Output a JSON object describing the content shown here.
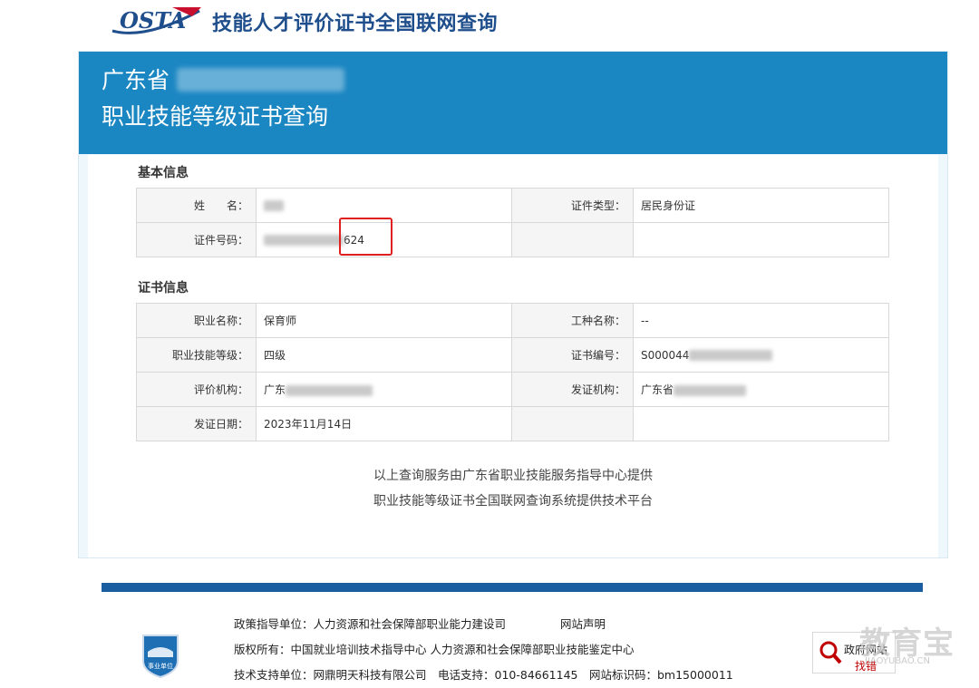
{
  "header": {
    "logo_text": "OSTA",
    "title": "技能人才评价证书全国联网查询"
  },
  "banner": {
    "line1": "广东省",
    "line2": "职业技能等级证书查询"
  },
  "basic": {
    "section_title": "基本信息",
    "name_label": "姓　　名：",
    "id_type_label": "证件类型：",
    "id_type_value": "居民身份证",
    "id_no_label": "证件号码：",
    "id_no_value_suffix": "624"
  },
  "cert": {
    "section_title": "证书信息",
    "occupation_label": "职业名称：",
    "occupation_value": "保育师",
    "trade_label": "工种名称：",
    "trade_value": "--",
    "level_label": "职业技能等级：",
    "level_value": "四级",
    "cert_no_label": "证书编号：",
    "cert_no_value": "S000044",
    "eval_org_label": "评价机构：",
    "eval_org_value": "广东",
    "issue_org_label": "发证机构：",
    "issue_org_value": "广东省",
    "issue_date_label": "发证日期：",
    "issue_date_value": "2023年11月14日"
  },
  "notes": {
    "line1": "以上查询服务由广东省职业技能服务指导中心提供",
    "line2": "职业技能等级证书全国联网查询系统提供技术平台"
  },
  "footer": {
    "policy": "政策指导单位：人力资源和社会保障部职业能力建设司",
    "statement": "网站声明",
    "copyright": "版权所有：中国就业培训技术指导中心 人力资源和社会保障部职业技能鉴定中心",
    "support": "技术支持单位：网鼎明天科技有限公司　电话支持：010-84661145　网站标识码：bm15000011",
    "badge_label": "事业单位",
    "gov_line1": "政府网站",
    "gov_line2": "找错",
    "watermark": "教育宝",
    "watermark_url": "JIAOYUBAO.CN"
  },
  "colors": {
    "banner": "#1a86c2",
    "title": "#1f4e8c",
    "footer_bar": "#1a5ea0",
    "highlight": "#e02020"
  }
}
